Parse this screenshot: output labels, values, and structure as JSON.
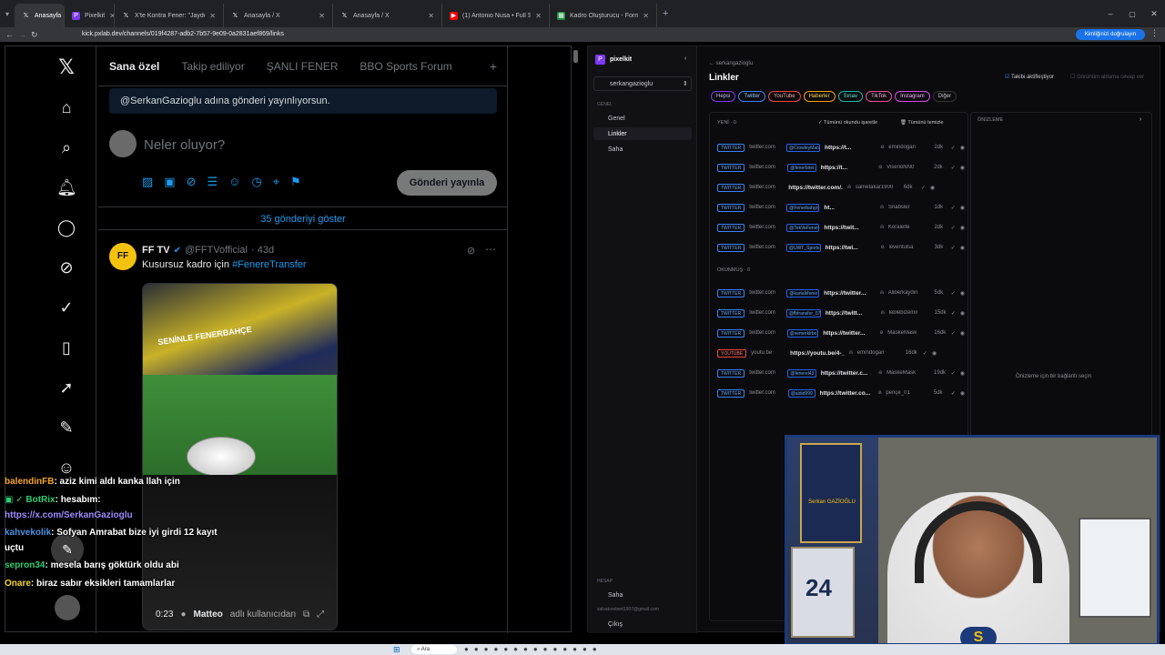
{
  "browser": {
    "tabs": [
      {
        "label": "Anasayfa",
        "icon": "x-icon",
        "active": true
      },
      {
        "label": "Pixelkit",
        "icon": "pixelkit-icon"
      },
      {
        "label": "X'te Kontra Fener: \"Jayden Oos...",
        "icon": "x-icon"
      },
      {
        "label": "Anasayfa / X",
        "icon": "x-icon"
      },
      {
        "label": "Anasayfa / X",
        "icon": "x-icon"
      },
      {
        "label": "(1) Antonio Nusa • Full Season",
        "icon": "youtube-icon"
      },
      {
        "label": "Kadro Oluşturucu - Formasyon...",
        "icon": "sheet-icon"
      }
    ],
    "url": "kick.pxlab.dev/channels/019f4287-adb2-7b57-9e09-0a2831aef869/links",
    "profile_label": "Kimliğinizi doğrulayın"
  },
  "x": {
    "tabs": [
      "Sana özel",
      "Takip ediliyor",
      "ŞANLI FENER",
      "BBO Sports Forum"
    ],
    "notice": "@SerkanGazioglu adına gönderi yayınlıyorsun.",
    "compose_placeholder": "Neler oluyor?",
    "post_button": "Gönderi yayınla",
    "show_new": "35 gönderiyi göster",
    "tweet": {
      "name": "FF TV",
      "handle": "@FFTVofficial",
      "time": "· 43d",
      "text": "Kusursuz kadro için",
      "hashtag": "#FenereTransfer",
      "video_time": "0:23",
      "video_user": "Matteo",
      "video_user_suffix": "adlı kullanıcıdan",
      "banner": "SENİNLE FENERBAHÇE"
    }
  },
  "chat": [
    {
      "user": "balendinFB",
      "msg": ": aziz kimi aldı kanka llah için",
      "color": "#f5a623"
    },
    {
      "user": "BotRix",
      "msg": ": hesabım:",
      "color": "#2ecc71"
    },
    {
      "user": "",
      "msg": "https://x.com/SerkanGazioglu",
      "color": "#9b8cff"
    },
    {
      "user": "kahvekolik",
      "msg": ": Sofyan Amrabat bize iyi girdi 12 kayıt",
      "color": "#4a90e2"
    },
    {
      "user": "",
      "msg": "uçtu",
      "color": "#fff"
    },
    {
      "user": "sepron34",
      "msg": ": mesela barış göktürk oldu abi",
      "color": "#2ecc71"
    },
    {
      "user": "Onare",
      "msg": ": biraz sabır eksikleri tamamlarlar",
      "color": "#f5d623"
    }
  ],
  "pixelkit": {
    "app_name": "pixelkit",
    "channel": "serkangazioglu",
    "section_general": "GENEL",
    "nav": [
      "Genel",
      "Linkler",
      "Saha"
    ],
    "section_account": "HESAP",
    "account_items": [
      "Saha",
      "Çıkış"
    ],
    "account_email": "salvatorebert1907@gmail.com",
    "back": "← serkangazioglu",
    "title": "Linkler",
    "toggle_follow": "Takibi aktifleştiyor",
    "toggle_view": "Görünüm ablama cevap ver",
    "filters": [
      "Hepsi",
      "Twitter",
      "YouTube",
      "Haberler",
      "Sınav",
      "TikTok",
      "Instagram",
      "Diğer"
    ],
    "new_label": "YENİ · 0",
    "mark_all": "Tümünü okundu işaretle",
    "clear_all": "Tümünü temizle",
    "read_label": "OKUNMUŞ · 0",
    "preview_label": "ÖNİZLEME",
    "preview_empty": "Önizleme için bir bağlantı seçin",
    "new_rows": [
      {
        "type": "TWITTER",
        "domain": "twitter.com",
        "chip": "@CrowleyMan",
        "link": "https://t...",
        "user": "emindogan",
        "age": "2dk"
      },
      {
        "type": "TWITTER",
        "domain": "twitter.com",
        "chip": "@fenerbirel",
        "link": "https://t...",
        "user": "ViserioNN0",
        "age": "2dk"
      },
      {
        "type": "TWITTER",
        "domain": "twitter.com",
        "chip": "",
        "link": "https://twitter.com/...",
        "user": "sametakar1900",
        "age": "6dk"
      },
      {
        "type": "TWITTER",
        "domain": "twitter.com",
        "chip": "@Fenerbahçe",
        "link": "ht...",
        "user": "Snabsler",
        "age": "1dk"
      },
      {
        "type": "TWITTER",
        "domain": "twitter.com",
        "chip": "@TekVeFener",
        "link": "https://twit...",
        "user": "Koralelte",
        "age": "2dk"
      },
      {
        "type": "TWITTER",
        "domain": "twitter.com",
        "chip": "@UWT_Sports",
        "link": "https://twi...",
        "user": "leventulsa",
        "age": "3dk"
      }
    ],
    "read_rows": [
      {
        "type": "TWITTER",
        "domain": "twitter.com",
        "chip": "@kartalsfener",
        "link": "https://twitter...",
        "user": "Aliberkaydin",
        "age": "5dk"
      },
      {
        "type": "TWITTER",
        "domain": "twitter.com",
        "chip": "@fbtransfer_07",
        "link": "https://twitt...",
        "user": "leblebizemil",
        "age": "15dk"
      },
      {
        "type": "TWITTER",
        "domain": "twitter.com",
        "chip": "@semerkirbo",
        "link": "https://twitter...",
        "user": "MaskeMask",
        "age": "16dk"
      },
      {
        "type": "YOUTUBE",
        "domain": "youtu.be",
        "chip": "",
        "link": "https://youtu.be/4-_eSNQOkuw",
        "user": "emindogan",
        "age": "16dk"
      },
      {
        "type": "TWITTER",
        "domain": "twitter.com",
        "chip": "@fenerel43",
        "link": "https://twitter.c...",
        "user": "MaskeMask",
        "age": "19dk"
      },
      {
        "type": "TWITTER",
        "domain": "twitter.com",
        "chip": "@aldid999",
        "link": "https://twitter.co...",
        "user": "pençe_01",
        "age": "5dk"
      }
    ]
  },
  "webcam": {
    "jersey_number": "24",
    "frame_name": "Serkan GAZİOĞLU"
  },
  "taskbar": {
    "search": "Ara"
  },
  "colors": {
    "x_blue": "#1d9bf0",
    "pk_accent": "#3b82f6",
    "cam_border": "#1b3a7a"
  }
}
